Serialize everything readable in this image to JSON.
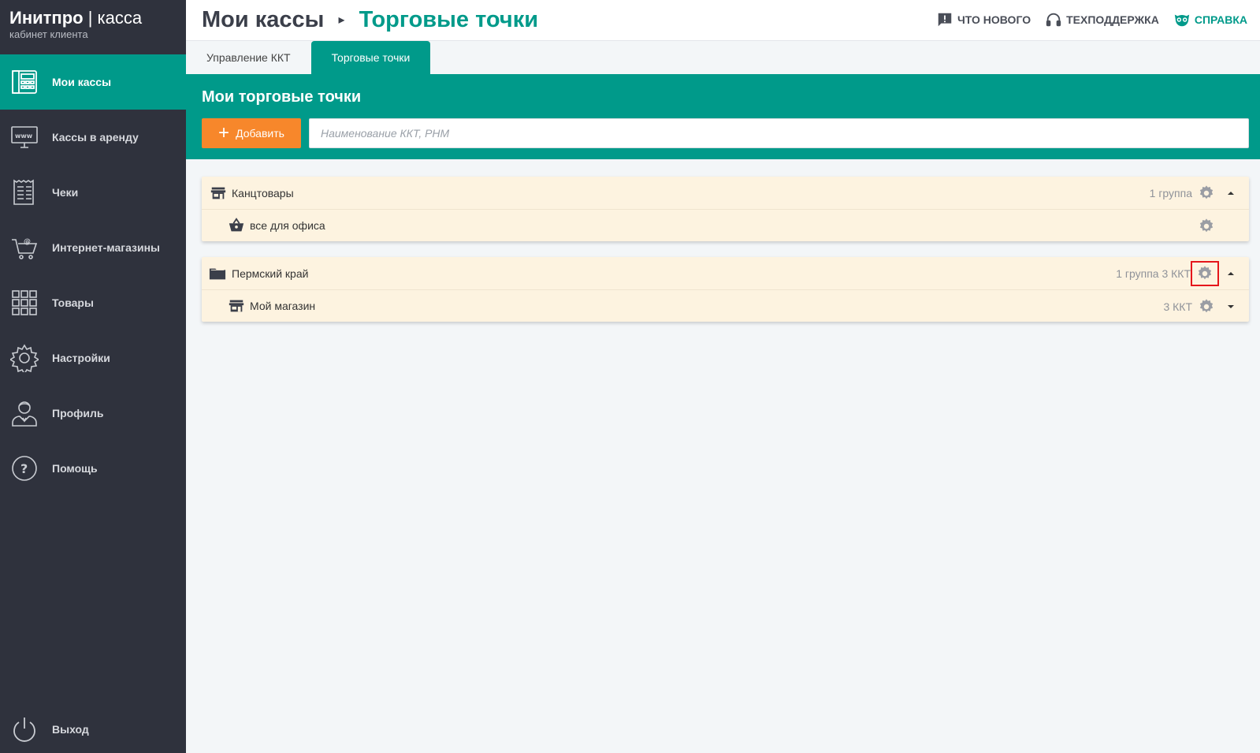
{
  "brand": {
    "name_bold": "Инитпро",
    "separator": " | ",
    "name_thin": "касса",
    "subtitle": "кабинет клиента"
  },
  "sidebar": {
    "items": [
      {
        "label": "Мои кассы",
        "icon": "cash-register-icon",
        "active": true
      },
      {
        "label": "Кассы в аренду",
        "icon": "www-monitor-icon"
      },
      {
        "label": "Чеки",
        "icon": "receipt-icon"
      },
      {
        "label": "Интернет-магазины",
        "icon": "online-cart-icon"
      },
      {
        "label": "Товары",
        "icon": "grid-icon"
      },
      {
        "label": "Настройки",
        "icon": "gear-icon"
      },
      {
        "label": "Профиль",
        "icon": "user-icon"
      },
      {
        "label": "Помощь",
        "icon": "help-icon"
      }
    ],
    "logout": {
      "label": "Выход",
      "icon": "power-icon"
    }
  },
  "header": {
    "breadcrumb_root": "Мои кассы",
    "breadcrumb_current": "Торговые точки",
    "links": {
      "news": "Что нового",
      "support": "Техподдержка",
      "help": "Справка"
    }
  },
  "tabs": [
    {
      "label": "Управление ККТ"
    },
    {
      "label": "Торговые точки",
      "active": true
    }
  ],
  "main": {
    "title": "Мои торговые точки",
    "add_label": "Добавить",
    "search_placeholder": "Наименование ККТ, РНМ"
  },
  "groups": [
    {
      "name": "Канцтовары",
      "meta": "1 группа",
      "children": [
        {
          "name": "все для офиса",
          "meta": ""
        }
      ]
    },
    {
      "name": "Пермский край",
      "meta": "1 группа 3 ККТ",
      "children": [
        {
          "name": "Мой магазин",
          "meta": "3 ККТ"
        }
      ]
    }
  ],
  "colors": {
    "accent": "#009a8a",
    "sidebar": "#2f323d",
    "add_button": "#f7872b",
    "card": "#fdf3e0",
    "highlight": "#e5161b"
  }
}
